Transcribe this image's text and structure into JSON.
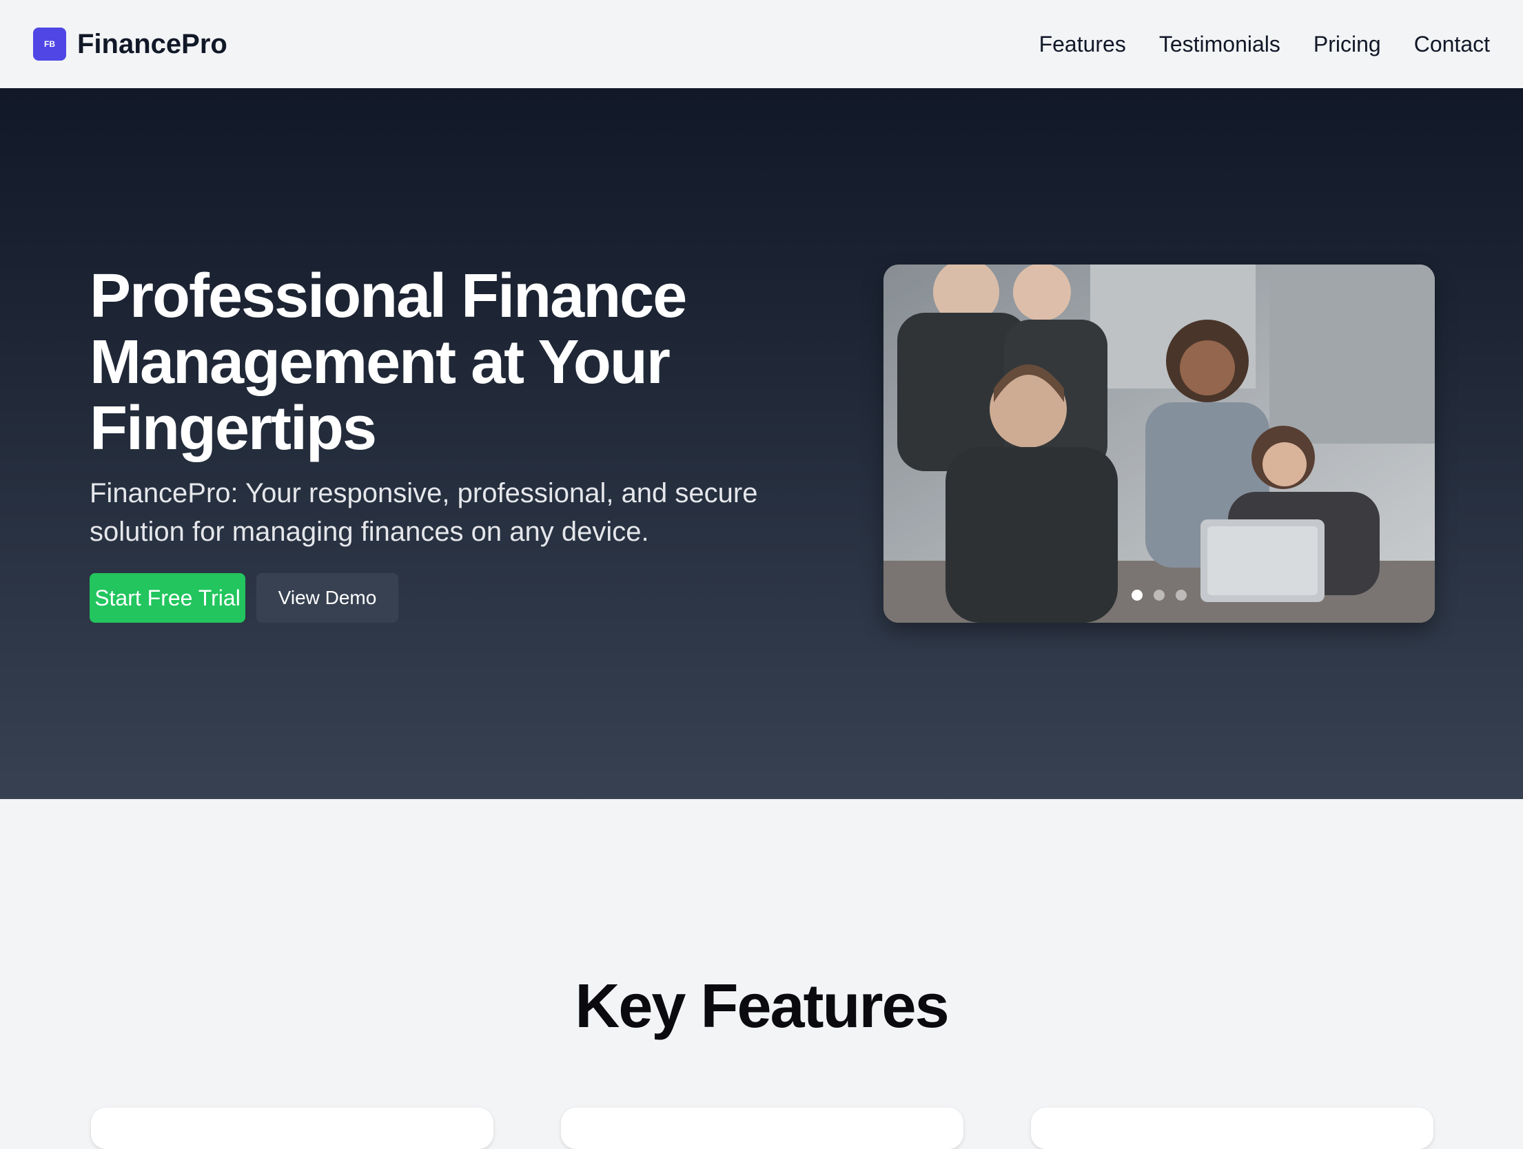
{
  "header": {
    "logo_text": "FB",
    "brand": "FinancePro",
    "nav": [
      "Features",
      "Testimonials",
      "Pricing",
      "Contact"
    ]
  },
  "hero": {
    "title": "Professional Finance Management at Your Fingertips",
    "subtitle": "FinancePro: Your responsive, professional, and secure solution for managing finances on any device.",
    "primary_cta": "Start Free Trial",
    "secondary_cta": "View Demo",
    "carousel": {
      "slide_count": 3,
      "active_slide": 1,
      "image_description": "team-working-at-laptop-photo"
    }
  },
  "features": {
    "title": "Key Features",
    "card_count": 3
  },
  "colors": {
    "accent": "#4f46e5",
    "cta_green": "#22c55e",
    "hero_top": "#111827",
    "hero_bottom": "#374151",
    "page_bg": "#f3f4f6"
  }
}
